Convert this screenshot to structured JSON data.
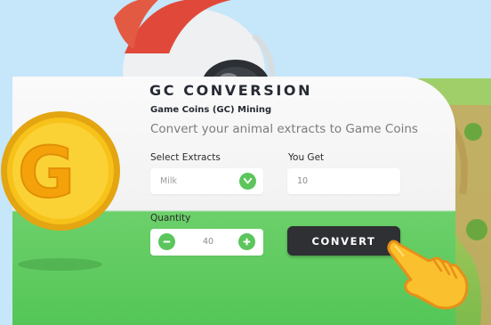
{
  "panel": {
    "title": "GC CONVERSION",
    "subtitle": "Game Coins (GC) Mining",
    "description": "Convert your animal extracts to Game Coins"
  },
  "coin": {
    "letter": "G"
  },
  "form": {
    "extracts_label": "Select Extracts",
    "extracts_value": "Milk",
    "you_get_label": "You Get",
    "you_get_value": "10",
    "quantity_label": "Quantity",
    "quantity_value": "40",
    "convert_label": "CONVERT"
  },
  "icons": {
    "dropdown": "chevron-down-icon",
    "decrement": "minus-icon",
    "increment": "plus-icon",
    "pointer": "pointing-hand-icon"
  },
  "colors": {
    "accent_green": "#5cc55c",
    "button_dark": "#2e3033",
    "coin_gold": "#f5c518",
    "background": "#c6e6f9"
  }
}
